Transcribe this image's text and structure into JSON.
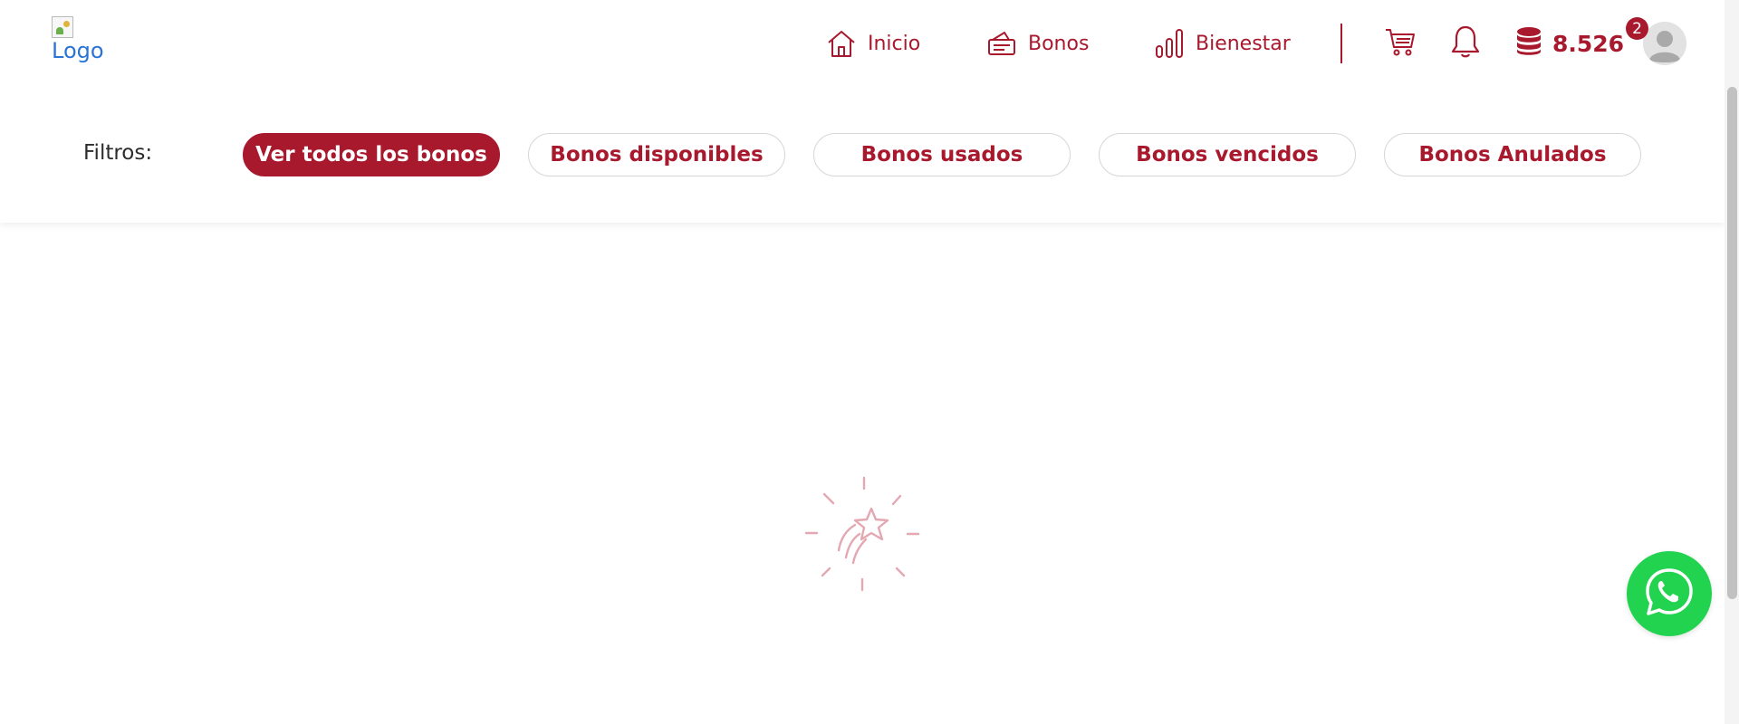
{
  "logo": {
    "alt_text": "Logo"
  },
  "nav": {
    "items": [
      {
        "label": "Inicio",
        "icon": "home-icon"
      },
      {
        "label": "Bonos",
        "icon": "ticket-icon"
      },
      {
        "label": "Bienestar",
        "icon": "bar-chart-icon"
      }
    ]
  },
  "header": {
    "cart_icon": "cart-icon",
    "bell_icon": "bell-icon",
    "points": {
      "value": "8.526",
      "icon": "coins-icon"
    },
    "notification_badge": "2",
    "avatar_icon": "user-avatar-icon"
  },
  "filters": {
    "label": "Filtros:",
    "options": [
      {
        "label": "Ver todos los bonos",
        "active": true
      },
      {
        "label": "Bonos disponibles",
        "active": false
      },
      {
        "label": "Bonos usados",
        "active": false
      },
      {
        "label": "Bonos vencidos",
        "active": false
      },
      {
        "label": "Bonos Anulados",
        "active": false
      }
    ]
  },
  "loader": {
    "icon": "shooting-star-icon"
  },
  "whatsapp": {
    "icon": "whatsapp-icon"
  },
  "colors": {
    "brand": "#a8192e",
    "whatsapp": "#21d34e",
    "loader": "#e3a8b2"
  }
}
